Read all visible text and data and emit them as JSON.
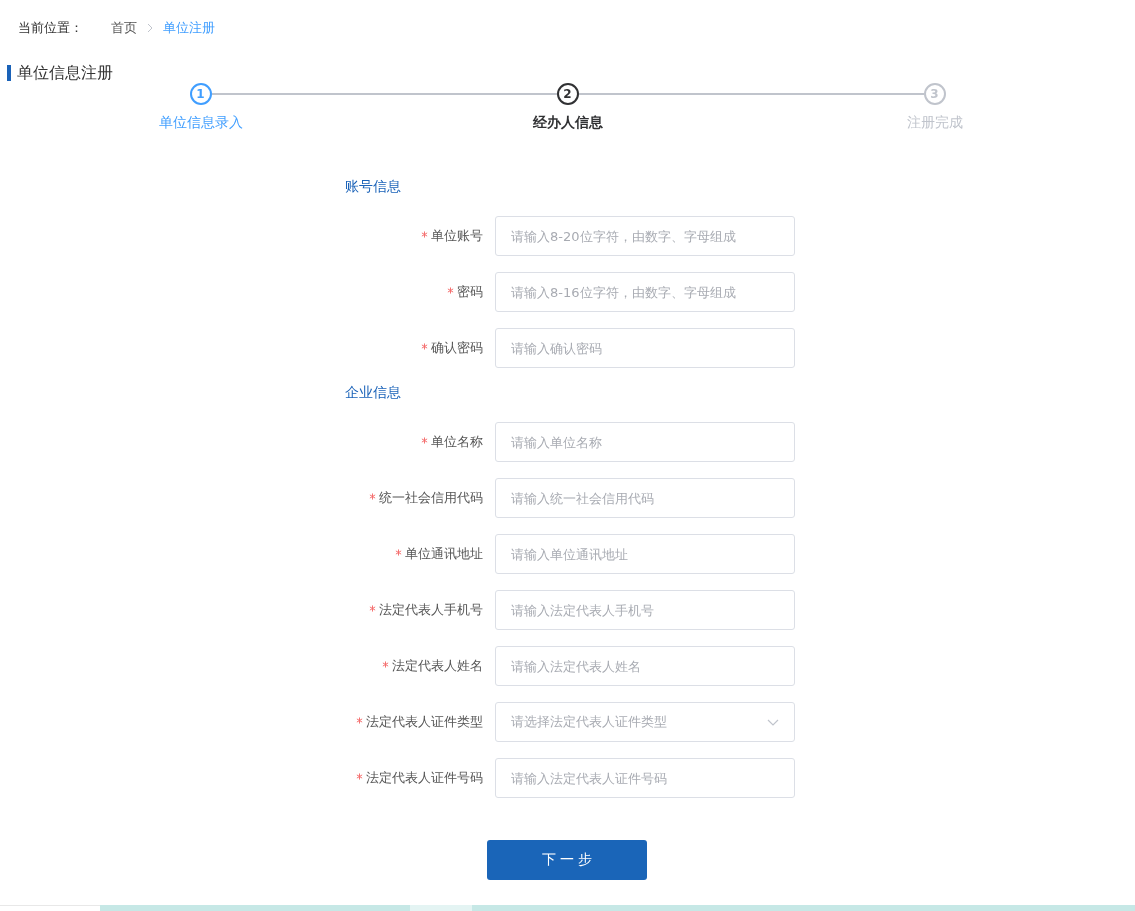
{
  "breadcrumb": {
    "label": "当前位置：",
    "items": [
      {
        "text": "首页",
        "selected": false
      },
      {
        "text": "单位注册",
        "selected": true
      }
    ]
  },
  "page_title": "单位信息注册",
  "steps": [
    {
      "number": "1",
      "label": "单位信息录入",
      "completed": true,
      "selected": false
    },
    {
      "number": "2",
      "label": "经办人信息",
      "completed": false,
      "selected": true
    },
    {
      "number": "3",
      "label": "注册完成",
      "completed": false,
      "selected": false
    }
  ],
  "sections": [
    {
      "title": "账号信息",
      "fields": [
        {
          "label": "单位账号",
          "required": true,
          "kind": "input",
          "placeholder": "请输入8-20位字符，由数字、字母组成"
        },
        {
          "label": "密码",
          "required": true,
          "kind": "input",
          "placeholder": "请输入8-16位字符，由数字、字母组成"
        },
        {
          "label": "确认密码",
          "required": true,
          "kind": "input",
          "placeholder": "请输入确认密码"
        }
      ]
    },
    {
      "title": "企业信息",
      "fields": [
        {
          "label": "单位名称",
          "required": true,
          "kind": "input",
          "placeholder": "请输入单位名称"
        },
        {
          "label": "统一社会信用代码",
          "required": true,
          "kind": "input",
          "placeholder": "请输入统一社会信用代码"
        },
        {
          "label": "单位通讯地址",
          "required": true,
          "kind": "input",
          "placeholder": "请输入单位通讯地址"
        },
        {
          "label": "法定代表人手机号",
          "required": true,
          "kind": "input",
          "placeholder": "请输入法定代表人手机号"
        },
        {
          "label": "法定代表人姓名",
          "required": true,
          "kind": "input",
          "placeholder": "请输入法定代表人姓名"
        },
        {
          "label": "法定代表人证件类型",
          "required": true,
          "kind": "select",
          "placeholder": "请选择法定代表人证件类型"
        },
        {
          "label": "法定代表人证件号码",
          "required": true,
          "kind": "input",
          "placeholder": "请输入法定代表人证件号码"
        }
      ]
    }
  ],
  "next_button": "下 一 步"
}
